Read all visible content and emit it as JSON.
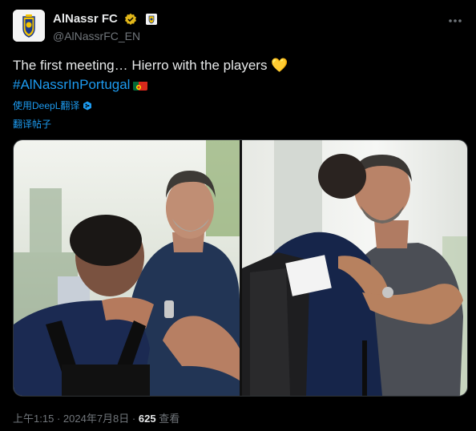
{
  "account": {
    "display_name": "AlNassr FC",
    "handle": "@AlNassrFC_EN"
  },
  "tweet": {
    "text_line1": "The first meeting… Hierro with the players",
    "heart_emoji": "💛",
    "hashtag": "#AlNassrInPortugal"
  },
  "translate": {
    "deepl_label": "使用DeepL翻译",
    "post_label": "翻译帖子"
  },
  "footer": {
    "time": "上午1:15",
    "date": "2024年7月8日",
    "sep": "·",
    "views_count": "625",
    "views_label": "查看"
  },
  "icons": {
    "verified": "verified-gold-badge",
    "affiliate": "club-crest-badge",
    "more": "more-horizontal-icon",
    "flag": "portugal-flag",
    "deepl": "deepl-icon"
  },
  "colors": {
    "background": "#000000",
    "text": "#e7e9ea",
    "muted": "#71767b",
    "accent": "#1d9bf0",
    "gold": "#e2b719"
  }
}
